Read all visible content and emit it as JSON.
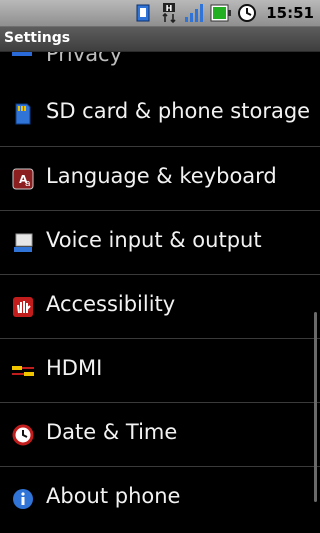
{
  "status_bar": {
    "time": "15:51",
    "icons": [
      "usb-icon",
      "hspa-icon",
      "signal-icon",
      "battery-icon",
      "alarm-icon"
    ]
  },
  "app": {
    "title": "Settings"
  },
  "list": {
    "partial_item": "Privacy",
    "items": [
      {
        "label": "SD card & phone storage",
        "icon": "sd-card-icon"
      },
      {
        "label": "Language & keyboard",
        "icon": "language-icon"
      },
      {
        "label": "Voice input & output",
        "icon": "voice-icon"
      },
      {
        "label": "Accessibility",
        "icon": "accessibility-icon"
      },
      {
        "label": "HDMI",
        "icon": "hdmi-icon"
      },
      {
        "label": "Date & Time",
        "icon": "clock-icon"
      },
      {
        "label": "About phone",
        "icon": "info-icon"
      }
    ]
  },
  "colors": {
    "accent": "#2a6ad8",
    "background": "#000000"
  }
}
